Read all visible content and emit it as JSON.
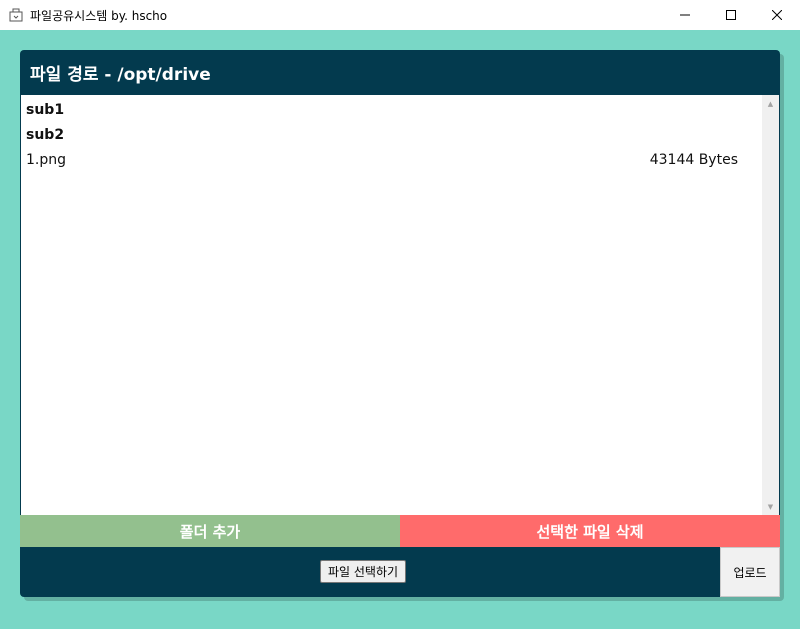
{
  "window": {
    "title": "파일공유시스템 by. hscho",
    "minimize": "—",
    "maximize": "☐",
    "close": "✕"
  },
  "panel": {
    "title": "파일 경로 - /opt/drive"
  },
  "files": [
    {
      "name": "sub1",
      "size": "",
      "type": "folder"
    },
    {
      "name": "sub2",
      "size": "",
      "type": "folder"
    },
    {
      "name": "1.png",
      "size": "43144 Bytes",
      "type": "file"
    }
  ],
  "actions": {
    "add_folder": "폴더 추가",
    "delete_selected": "선택한 파일 삭제"
  },
  "upload": {
    "choose_file": "파일 선택하기",
    "upload": "업로드"
  },
  "colors": {
    "background": "#79d7c6",
    "panel": "#033a4e",
    "add_folder": "#93c08e",
    "delete": "#ff6b6b"
  }
}
